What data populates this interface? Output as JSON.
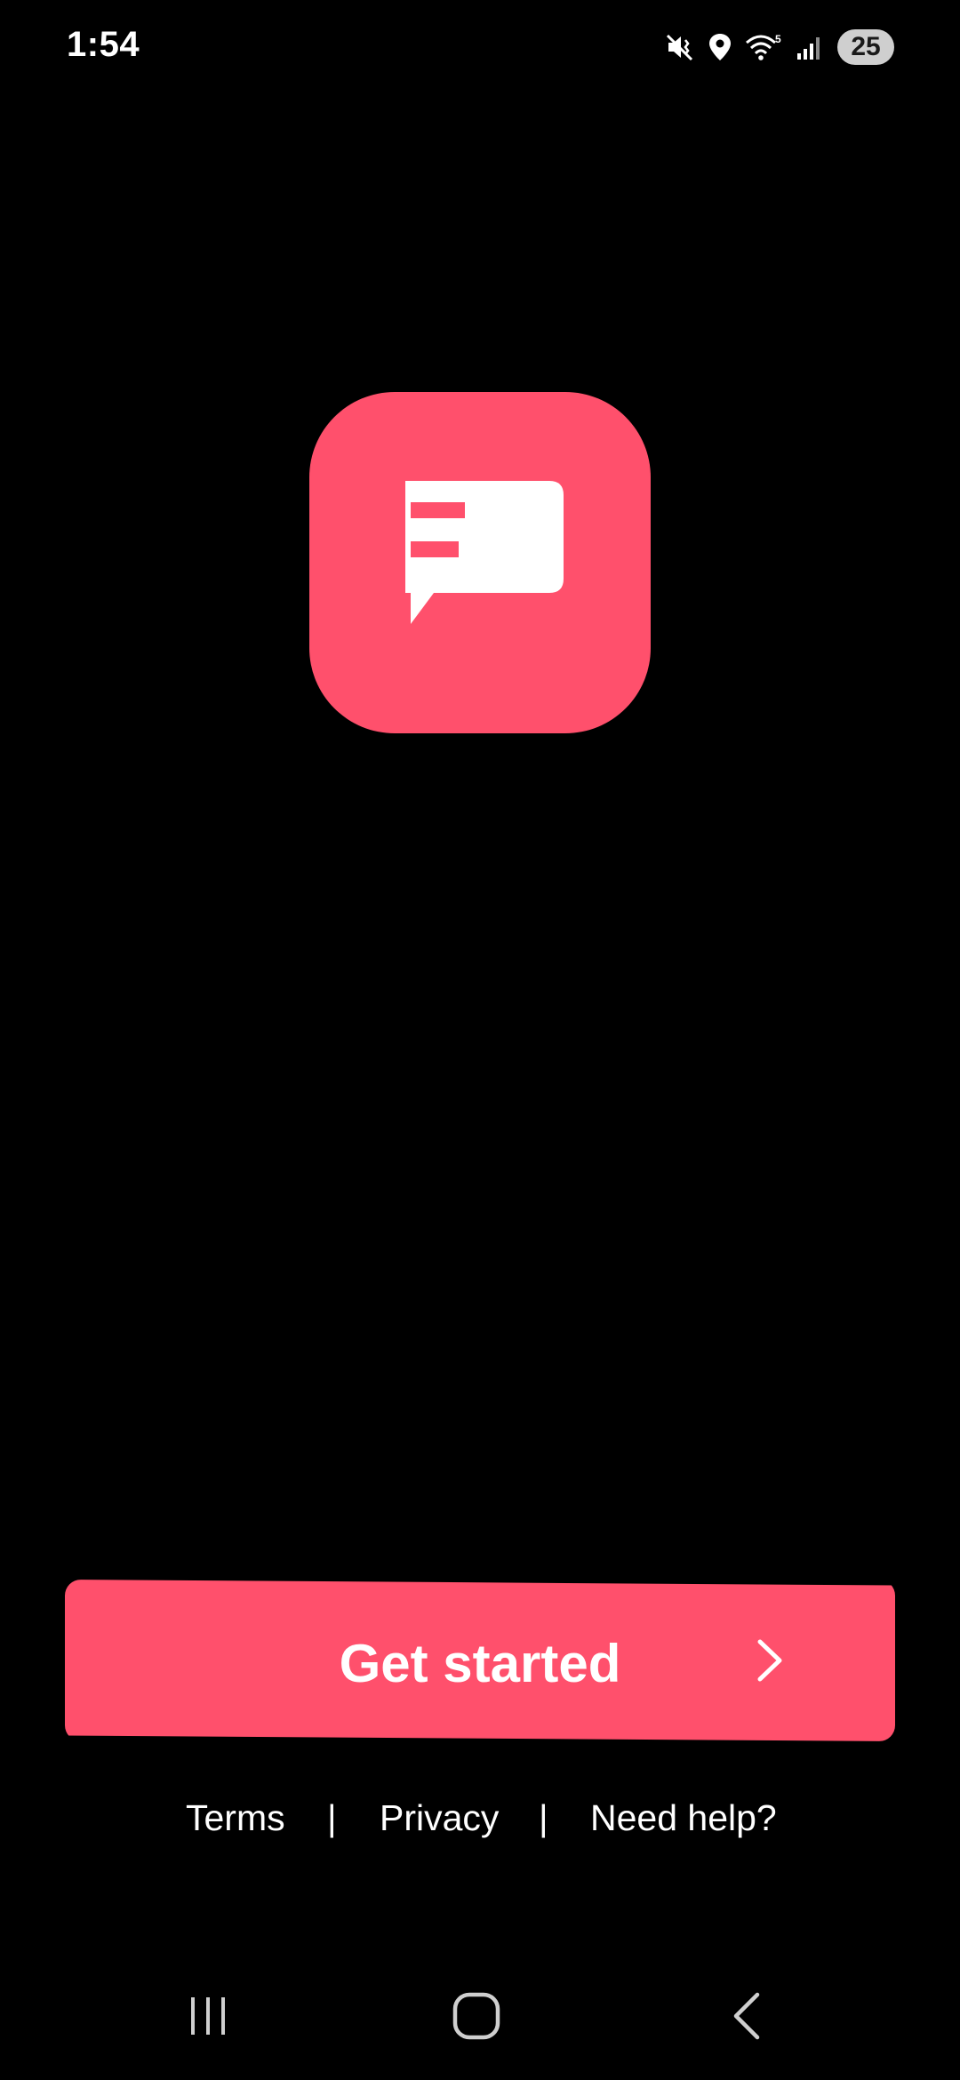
{
  "status_bar": {
    "time": "1:54",
    "battery_level": "25",
    "icons": [
      "mute-vibrate-icon",
      "location-icon",
      "wifi-icon",
      "signal-icon",
      "battery-icon"
    ]
  },
  "app": {
    "logo_icon": "chat-bubble-logo-icon",
    "brand_color": "#ff506c",
    "logo_glyph_color": "#ffffff"
  },
  "cta": {
    "label": "Get started",
    "arrow_icon": "chevron-right-icon"
  },
  "footer": {
    "links": [
      "Terms",
      "Privacy",
      "Need help?"
    ],
    "separator": "|"
  },
  "nav_bar": {
    "icons": [
      "recent-apps-icon",
      "home-icon",
      "back-icon"
    ]
  },
  "colors": {
    "background": "#000000",
    "text": "#ffffff",
    "accent": "#ff506c"
  }
}
